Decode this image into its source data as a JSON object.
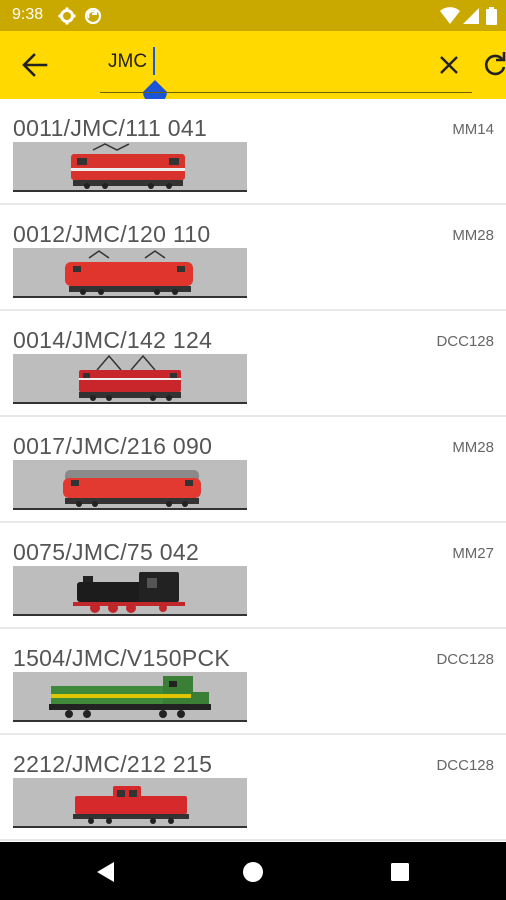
{
  "status_bar": {
    "time": "9:38",
    "icons": [
      "gear-icon",
      "sync-icon",
      "wifi-icon",
      "signal-icon",
      "battery-icon"
    ]
  },
  "toolbar": {
    "search_value": "JMC",
    "icons": [
      "back-arrow-icon",
      "clear-icon",
      "refresh-icon"
    ],
    "accent_color": "#ffd900"
  },
  "locomotives": [
    {
      "name": "0011/JMC/111 041",
      "protocol": "MM14",
      "image_icon": "electric-locomotive-icon"
    },
    {
      "name": "0012/JMC/120 110",
      "protocol": "MM28",
      "image_icon": "electric-locomotive-icon"
    },
    {
      "name": "0014/JMC/142 124",
      "protocol": "DCC128",
      "image_icon": "electric-locomotive-icon"
    },
    {
      "name": "0017/JMC/216 090",
      "protocol": "MM28",
      "image_icon": "diesel-locomotive-icon"
    },
    {
      "name": "0075/JMC/75 042",
      "protocol": "MM27",
      "image_icon": "steam-locomotive-icon"
    },
    {
      "name": "1504/JMC/V150PCK",
      "protocol": "DCC128",
      "image_icon": "diesel-locomotive-icon"
    },
    {
      "name": "2212/JMC/212 215",
      "protocol": "DCC128",
      "image_icon": "diesel-locomotive-icon"
    }
  ],
  "nav_bar": {
    "icons": [
      "back-triangle-icon",
      "home-circle-icon",
      "recents-square-icon"
    ]
  }
}
